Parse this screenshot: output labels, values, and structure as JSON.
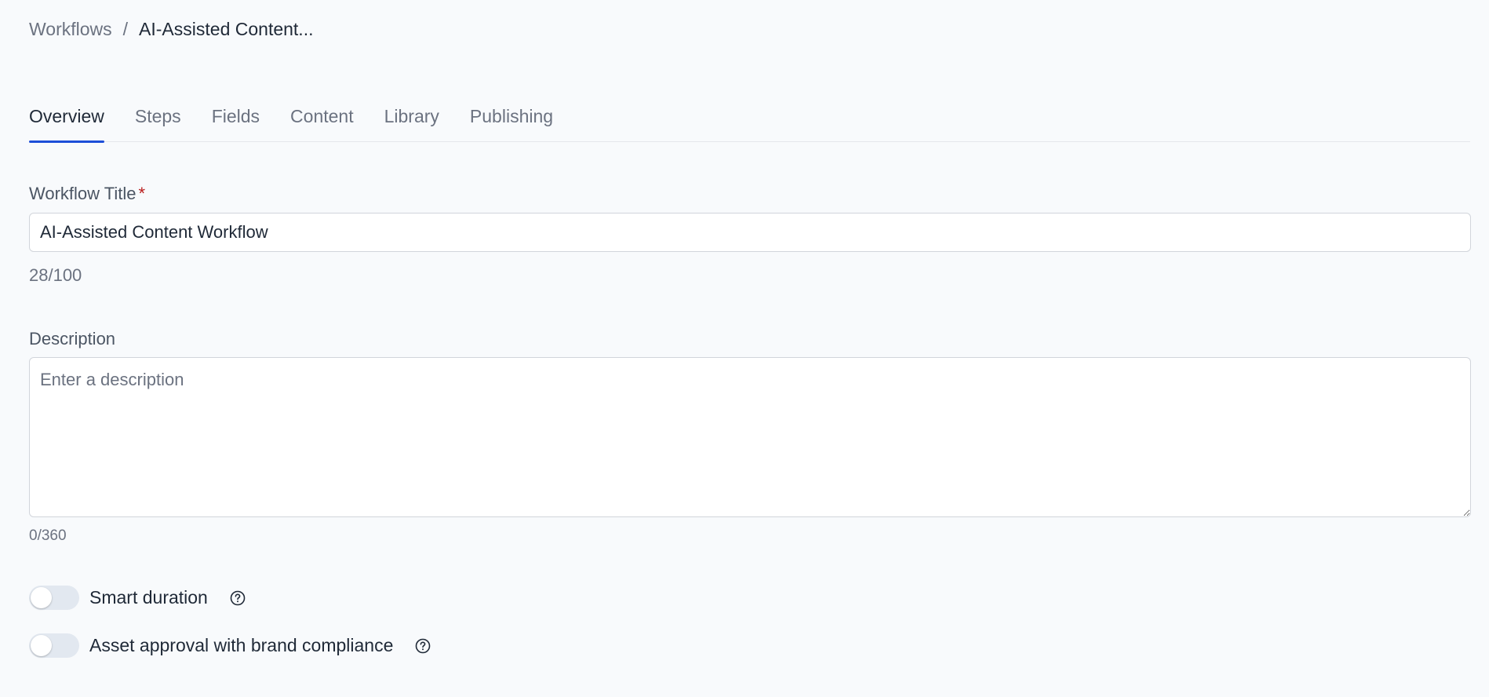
{
  "breadcrumb": {
    "parent": "Workflows",
    "separator": "/",
    "current": "AI-Assisted Content..."
  },
  "tabs": [
    {
      "label": "Overview",
      "active": true
    },
    {
      "label": "Steps",
      "active": false
    },
    {
      "label": "Fields",
      "active": false
    },
    {
      "label": "Content",
      "active": false
    },
    {
      "label": "Library",
      "active": false
    },
    {
      "label": "Publishing",
      "active": false
    }
  ],
  "form": {
    "title": {
      "label": "Workflow Title",
      "required_marker": "*",
      "value": "AI-Assisted Content Workflow",
      "counter": "28/100"
    },
    "description": {
      "label": "Description",
      "placeholder": "Enter a description",
      "value": "",
      "counter": "0/360"
    }
  },
  "toggles": [
    {
      "label": "Smart duration",
      "enabled": false,
      "help_icon": "question-circle-icon"
    },
    {
      "label": "Asset approval with brand compliance",
      "enabled": false,
      "help_icon": "question-circle-icon"
    }
  ],
  "colors": {
    "background": "#f8fafc",
    "accent": "#1d4ed8",
    "required": "#b91c1c",
    "toggle_off": "#e2e8f0",
    "muted_text": "#6b7280"
  }
}
